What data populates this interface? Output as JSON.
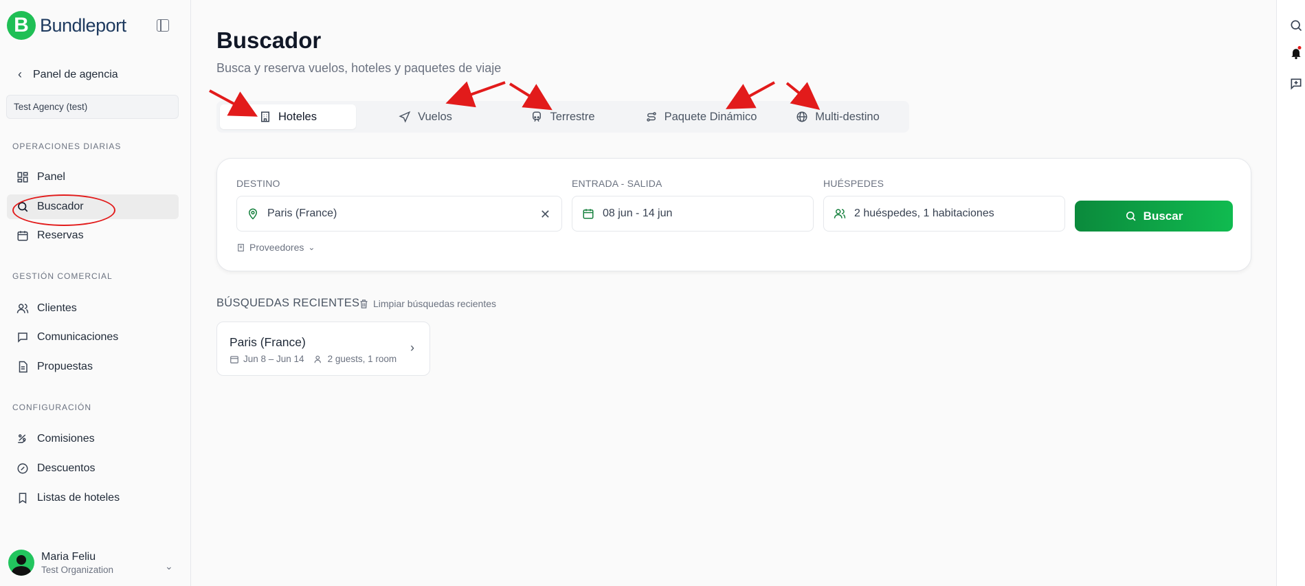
{
  "brand": {
    "logo_letter": "B",
    "name": "Bundleport"
  },
  "sidebar": {
    "back_label": "Panel de agencia",
    "agency": "Test Agency (test)",
    "sections": [
      {
        "label": "OPERACIONES DIARIAS",
        "items": [
          {
            "label": "Panel",
            "icon": "dashboard-icon"
          },
          {
            "label": "Buscador",
            "icon": "search-icon"
          },
          {
            "label": "Reservas",
            "icon": "calendar-icon"
          }
        ]
      },
      {
        "label": "GESTIÓN COMERCIAL",
        "items": [
          {
            "label": "Clientes",
            "icon": "users-icon"
          },
          {
            "label": "Comunicaciones",
            "icon": "message-icon"
          },
          {
            "label": "Propuestas",
            "icon": "document-icon"
          }
        ]
      },
      {
        "label": "CONFIGURACIÓN",
        "items": [
          {
            "label": "Comisiones",
            "icon": "percent-hand-icon"
          },
          {
            "label": "Descuentos",
            "icon": "discount-icon"
          },
          {
            "label": "Listas de hoteles",
            "icon": "bookmark-icon"
          }
        ]
      }
    ],
    "active_item": "Buscador",
    "user": {
      "name": "Maria Feliu",
      "org": "Test Organization"
    }
  },
  "main": {
    "title": "Buscador",
    "subtitle": "Busca y reserva vuelos, hoteles y paquetes de viaje",
    "tabs": [
      {
        "label": "Hoteles",
        "icon": "hotel-icon",
        "active": true
      },
      {
        "label": "Vuelos",
        "icon": "plane-icon",
        "active": false
      },
      {
        "label": "Terrestre",
        "icon": "train-icon",
        "active": false
      },
      {
        "label": "Paquete Dinámico",
        "icon": "route-icon",
        "active": false
      },
      {
        "label": "Multi-destino",
        "icon": "globe-icon",
        "active": false
      }
    ],
    "search": {
      "destino_label": "DESTINO",
      "destino_value": "Paris (France)",
      "fechas_label": "ENTRADA - SALIDA",
      "fechas_value": "08 jun - 14 jun",
      "huespedes_label": "HUÉSPEDES",
      "huespedes_value": "2 huéspedes, 1 habitaciones",
      "button_label": "Buscar",
      "providers_label": "Proveedores"
    },
    "recent": {
      "title": "BÚSQUEDAS RECIENTES",
      "clear_label": "Limpiar búsquedas recientes",
      "items": [
        {
          "city": "Paris (France)",
          "dates": "Jun 8 – Jun 14",
          "guests": "2 guests, 1 room"
        }
      ]
    }
  },
  "colors": {
    "accent": "#10bb50",
    "annotation": "#e21b1b"
  }
}
